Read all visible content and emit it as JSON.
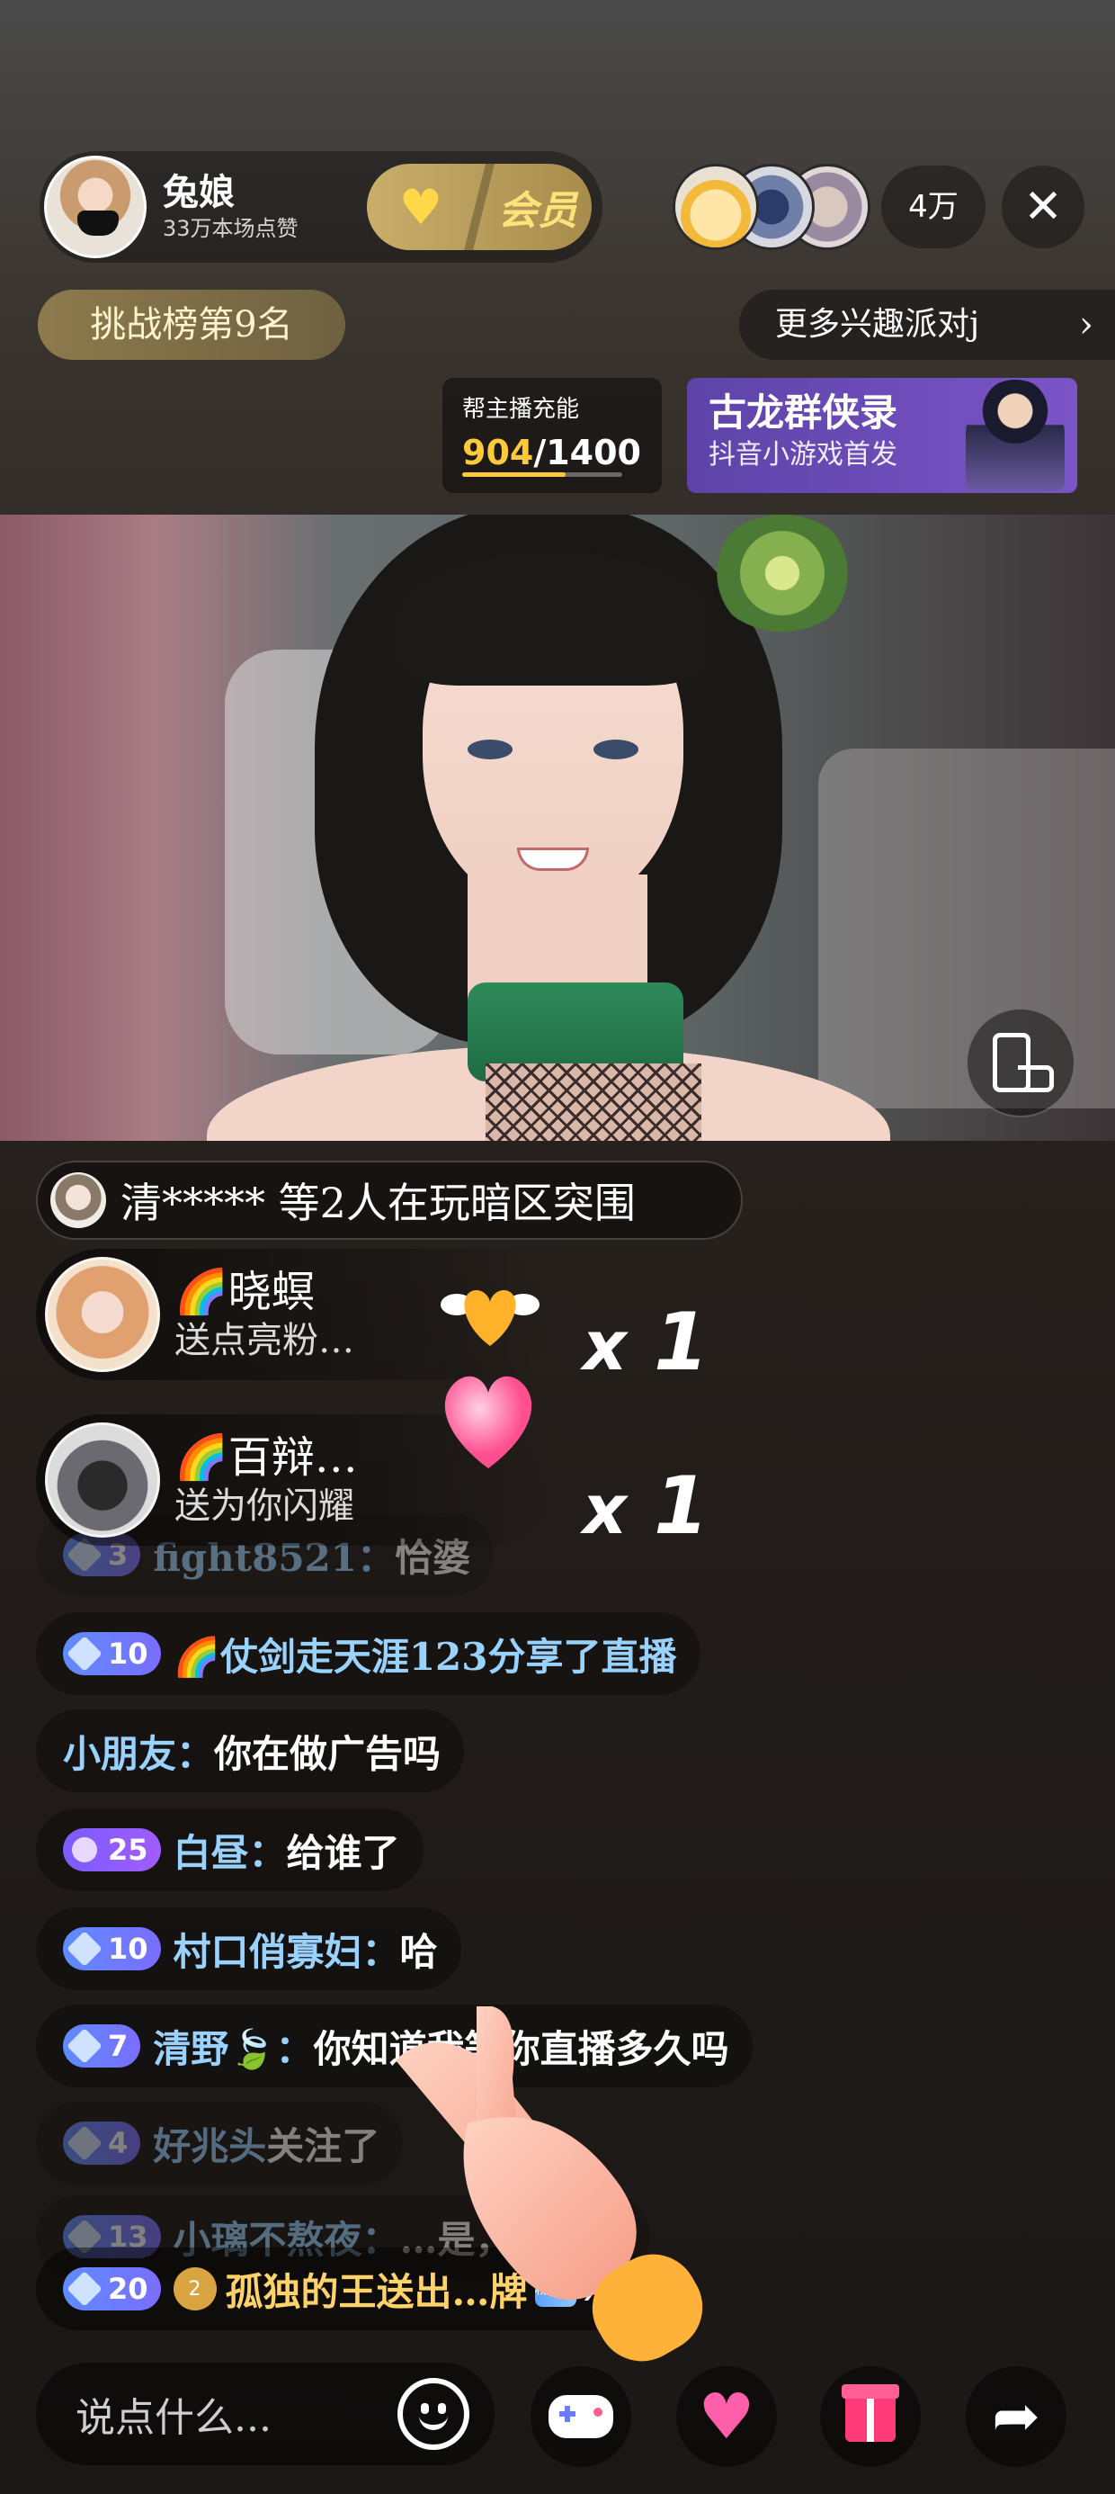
{
  "host": {
    "name": "兔娘",
    "likes": "33万本场点赞",
    "member_label": "会员"
  },
  "viewers": {
    "count": "4万"
  },
  "rank": {
    "label": "挑战榜第9名"
  },
  "more_party": {
    "label": "更多兴趣派对j"
  },
  "charge": {
    "title": "帮主播充能",
    "current": "904",
    "total": "/1400",
    "progress": 0.6457
  },
  "game_banner": {
    "title": "古龙群侠录",
    "subtitle": "抖音小游戏首发"
  },
  "game_notice": {
    "text": "清***** 等2人在玩暗区突围"
  },
  "gifts": [
    {
      "user": "🌈晓螟",
      "desc": "送点亮粉…",
      "multiplier": "x",
      "count": "1",
      "icon": "winged-heart-icon"
    },
    {
      "user": "🌈百辩…",
      "desc": "送为你闪耀",
      "multiplier": "x",
      "count": "1",
      "icon": "pink-heart-icon"
    }
  ],
  "chat": [
    {
      "level": "3",
      "user": "fight8521：",
      "msg": "恰婆",
      "faded": true
    },
    {
      "level": "10",
      "user": "🌈仗剑走天涯123",
      "msg": " 分享了直播"
    },
    {
      "level": "",
      "user": "小朋友：",
      "msg": "你在做广告吗"
    },
    {
      "level": "25",
      "user": "白昼：",
      "msg": "给谁了"
    },
    {
      "level": "10",
      "user": "村口俏寡妇：",
      "msg": "哈"
    },
    {
      "level": "7",
      "user": "清野🍃：",
      "msg": "你知道我等你直播多久吗"
    },
    {
      "level": "4",
      "user": "好兆头",
      "msg": " 关注了",
      "faded": true
    },
    {
      "level": "13",
      "user": "小璃不熬夜：",
      "msg": "…是，还想和",
      "faded": true
    }
  ],
  "gift_line": {
    "level": "20",
    "fan_level": "2",
    "user": "孤独的王",
    "msg": " 送出…牌",
    "badge": "粉丝团",
    "mult": "x1"
  },
  "input": {
    "placeholder": "说点什么..."
  },
  "colors": {
    "level_blue": "#5f8cff",
    "level_purple": "#7b5cff",
    "gold": "#ffc93c",
    "username_blue": "#9ad2ff"
  }
}
